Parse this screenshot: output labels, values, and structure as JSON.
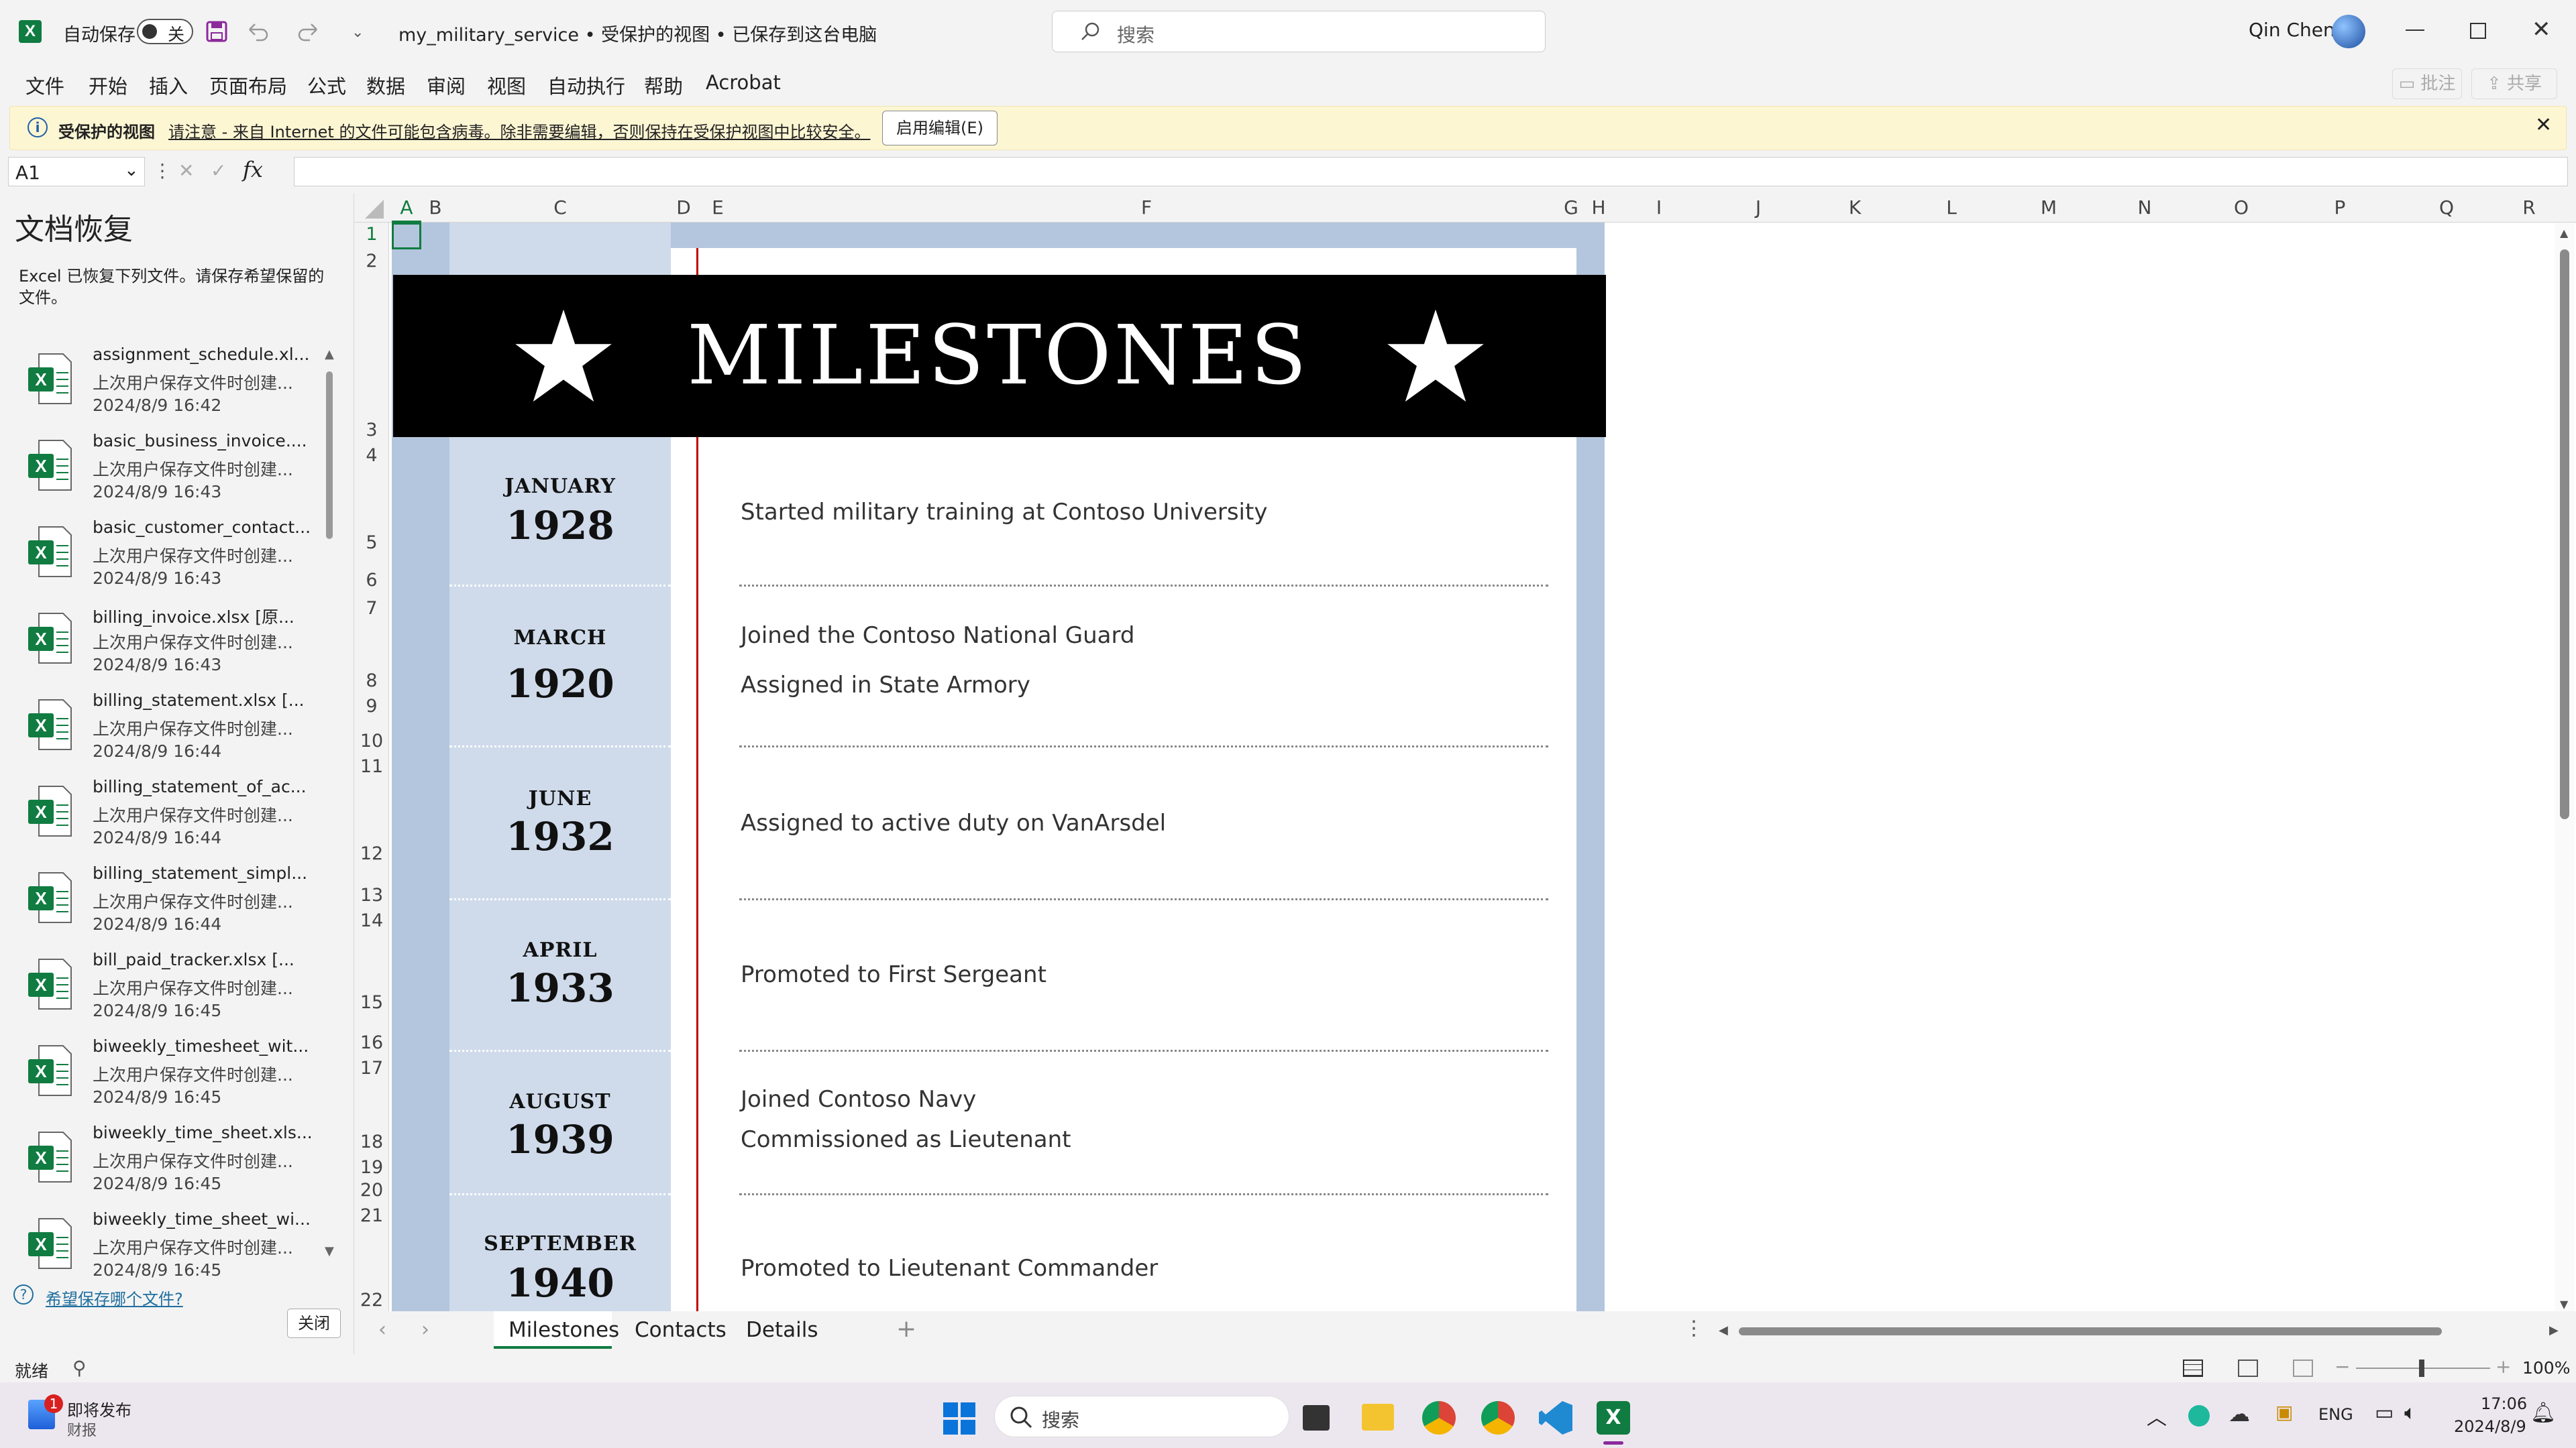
{
  "app": {
    "autosave_label": "自动保存",
    "autosave_state": "关",
    "doc_title": "my_military_service • 受保护的视图 • 已保存到这台电脑",
    "search_placeholder": "搜索",
    "user_name": "Qin Chen"
  },
  "menu": {
    "items": [
      "文件",
      "开始",
      "插入",
      "页面布局",
      "公式",
      "数据",
      "审阅",
      "视图",
      "自动执行",
      "帮助",
      "Acrobat"
    ],
    "comments_label": "批注",
    "share_label": "共享"
  },
  "protected_banner": {
    "title": "受保护的视图",
    "message": "请注意 - 来自 Internet 的文件可能包含病毒。除非需要编辑，否则保持在受保护视图中比较安全。",
    "enable_button": "启用编辑(E)"
  },
  "formula_bar": {
    "name_box": "A1",
    "fx_label": "fx",
    "content": ""
  },
  "recovery": {
    "title": "文档恢复",
    "description": "Excel 已恢复下列文件。请保存希望保留的文件。",
    "files": [
      {
        "name": "assignment_schedule.xl...",
        "desc": "上次用户保存文件时创建...",
        "date": "2024/8/9 16:42"
      },
      {
        "name": "basic_business_invoice....",
        "desc": "上次用户保存文件时创建...",
        "date": "2024/8/9 16:43"
      },
      {
        "name": "basic_customer_contact...",
        "desc": "上次用户保存文件时创建...",
        "date": "2024/8/9 16:43"
      },
      {
        "name": "billing_invoice.xlsx  [原...",
        "desc": "上次用户保存文件时创建...",
        "date": "2024/8/9 16:43"
      },
      {
        "name": "billing_statement.xlsx  [...",
        "desc": "上次用户保存文件时创建...",
        "date": "2024/8/9 16:44"
      },
      {
        "name": "billing_statement_of_ac...",
        "desc": "上次用户保存文件时创建...",
        "date": "2024/8/9 16:44"
      },
      {
        "name": "billing_statement_simpl...",
        "desc": "上次用户保存文件时创建...",
        "date": "2024/8/9 16:44"
      },
      {
        "name": "bill_paid_tracker.xlsx  [...",
        "desc": "上次用户保存文件时创建...",
        "date": "2024/8/9 16:45"
      },
      {
        "name": "biweekly_timesheet_wit...",
        "desc": "上次用户保存文件时创建...",
        "date": "2024/8/9 16:45"
      },
      {
        "name": "biweekly_time_sheet.xls...",
        "desc": "上次用户保存文件时创建...",
        "date": "2024/8/9 16:45"
      },
      {
        "name": "biweekly_time_sheet_wi...",
        "desc": "上次用户保存文件时创建...",
        "date": "2024/8/9 16:45"
      }
    ],
    "help_link": "希望保存哪个文件?",
    "close_button": "关闭"
  },
  "sheet": {
    "columns": [
      "A",
      "B",
      "C",
      "D",
      "E",
      "F",
      "G",
      "H",
      "I",
      "J",
      "K",
      "L",
      "M",
      "N",
      "O",
      "P",
      "Q",
      "R"
    ],
    "rows": [
      "1",
      "2",
      "3",
      "4",
      "5",
      "6",
      "7",
      "8",
      "9",
      "10",
      "11",
      "12",
      "13",
      "14",
      "15",
      "16",
      "17",
      "18",
      "19",
      "20",
      "21",
      "22"
    ],
    "header_title": "MILESTONES",
    "milestones": [
      {
        "month": "JANUARY",
        "year": "1928",
        "events": [
          "Started military training at Contoso University"
        ]
      },
      {
        "month": "MARCH",
        "year": "1920",
        "events": [
          "Joined the Contoso National Guard",
          "Assigned in State Armory"
        ]
      },
      {
        "month": "JUNE",
        "year": "1932",
        "events": [
          "Assigned to active duty on VanArsdel"
        ]
      },
      {
        "month": "APRIL",
        "year": "1933",
        "events": [
          "Promoted to First Sergeant"
        ]
      },
      {
        "month": "AUGUST",
        "year": "1939",
        "events": [
          "Joined Contoso Navy",
          "Commissioned as Lieutenant"
        ]
      },
      {
        "month": "SEPTEMBER",
        "year": "1940",
        "events": [
          "Promoted to Lieutenant Commander"
        ]
      }
    ]
  },
  "tabs": [
    "Milestones",
    "Contacts",
    "Details"
  ],
  "status": {
    "ready": "就绪",
    "zoom": "100%"
  },
  "taskbar": {
    "news_title": "即将发布",
    "news_sub": "财报",
    "news_badge": "1",
    "search_placeholder": "搜索",
    "lang": "ENG",
    "time": "17:06",
    "date": "2024/8/9"
  },
  "colors": {
    "accent_green": "#107c41",
    "band_blue": "#b4c6de",
    "band_light": "#cfdbeb",
    "header_black": "#000000",
    "red_line": "#c00000"
  }
}
